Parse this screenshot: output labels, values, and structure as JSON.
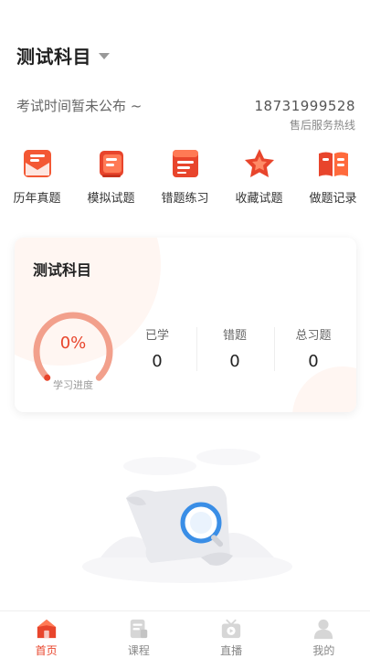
{
  "header": {
    "subject": "测试科目"
  },
  "exam": {
    "time_text": "考试时间暂未公布 ~"
  },
  "hotline": {
    "number": "18731999528",
    "label": "售后服务热线"
  },
  "quick_menu": [
    {
      "label": "历年真题",
      "icon": "past-exams-icon"
    },
    {
      "label": "模拟试题",
      "icon": "mock-exam-icon"
    },
    {
      "label": "错题练习",
      "icon": "wrong-questions-icon"
    },
    {
      "label": "收藏试题",
      "icon": "star-icon"
    },
    {
      "label": "做题记录",
      "icon": "book-icon"
    }
  ],
  "progress_card": {
    "title": "测试科目",
    "progress_text": "0%",
    "progress": 0,
    "progress_label": "学习进度",
    "stats": [
      {
        "label": "已学",
        "value": "0"
      },
      {
        "label": "错题",
        "value": "0"
      },
      {
        "label": "总习题",
        "value": "0"
      }
    ]
  },
  "tabbar": [
    {
      "label": "首页",
      "icon": "home-icon",
      "active": true
    },
    {
      "label": "课程",
      "icon": "course-icon",
      "active": false
    },
    {
      "label": "直播",
      "icon": "live-tv-icon",
      "active": false
    },
    {
      "label": "我的",
      "icon": "user-icon",
      "active": false
    }
  ],
  "colors": {
    "accent": "#e8452c",
    "gauge_track": "#f2a08c",
    "inactive_icon": "#d6d6d6"
  }
}
